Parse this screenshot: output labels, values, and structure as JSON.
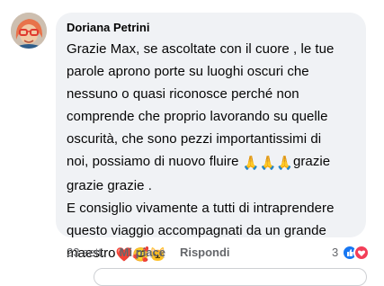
{
  "comment": {
    "author": "Doriana Petrini",
    "lines": [
      "Grazie Max, se ascoltate con il cuore , le tue",
      "parole aprono porte su luoghi oscuri che",
      "nessuno o quasi riconosce perché non",
      "comprende che proprio lavorando su quelle",
      "oscurità, che sono pezzi importantissimi di",
      "noi, possiamo di nuovo fluire",
      "grazie",
      "grazie grazie .",
      " E consiglio vivamente a tutti di intraprendere",
      "questo viaggio accompagnati da un grande",
      "maestro"
    ],
    "pray_emoji": "🙏",
    "end_emojis": [
      "❤️",
      "🥰",
      "🐱"
    ]
  },
  "actions": {
    "time": "23 sett.",
    "like": "Mi piace",
    "reply": "Rispondi"
  },
  "reactions": {
    "count": "3",
    "types": [
      "like",
      "love"
    ],
    "colors": {
      "like": "#1877f2",
      "love": "#f33e58"
    }
  }
}
